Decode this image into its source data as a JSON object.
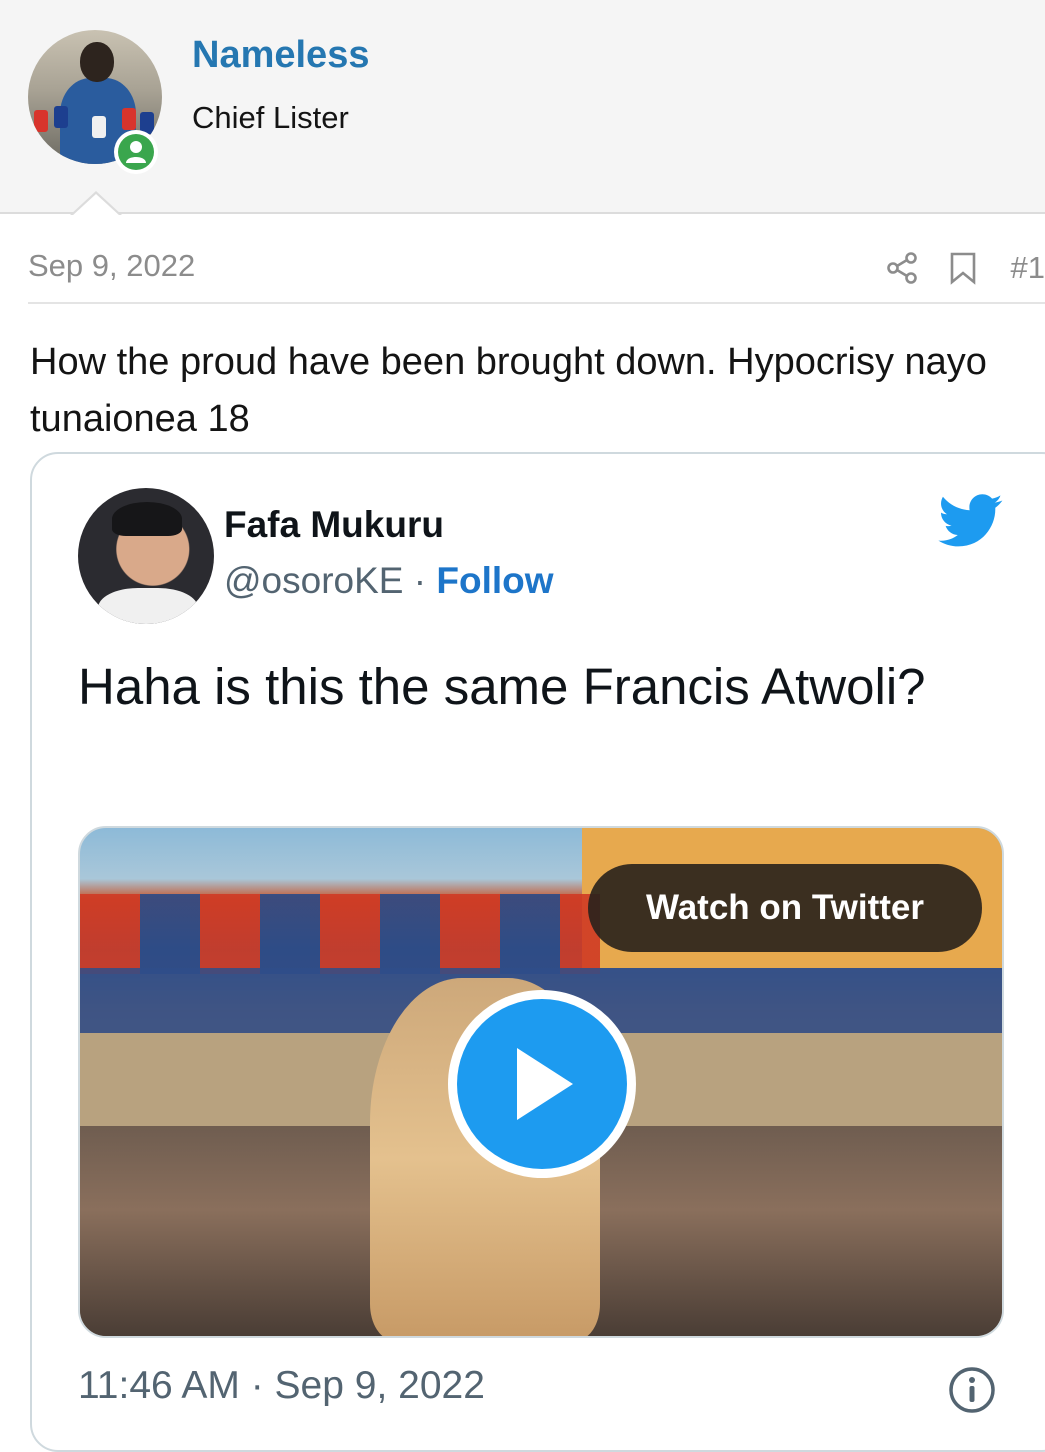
{
  "user": {
    "name": "Nameless",
    "title": "Chief Lister",
    "status": "online"
  },
  "post": {
    "date": "Sep 9, 2022",
    "number": "#1",
    "text": "How the proud have been brought down. Hypocrisy nayo tunaionea 18",
    "actions": [
      "share-icon",
      "bookmark-icon"
    ]
  },
  "tweet": {
    "author_name": "Fafa Mukuru",
    "handle": "@osoroKE",
    "separator": "·",
    "follow_label": "Follow",
    "text": "Haha is this the same Francis Atwoli?",
    "watch_label": "Watch on Twitter",
    "timestamp": "11:46 AM · Sep 9, 2022"
  },
  "colors": {
    "link_blue": "#2577b1",
    "twitter_blue": "#1d9bf0",
    "online_green": "#3aa64d",
    "muted_gray": "#8c8c8c"
  }
}
